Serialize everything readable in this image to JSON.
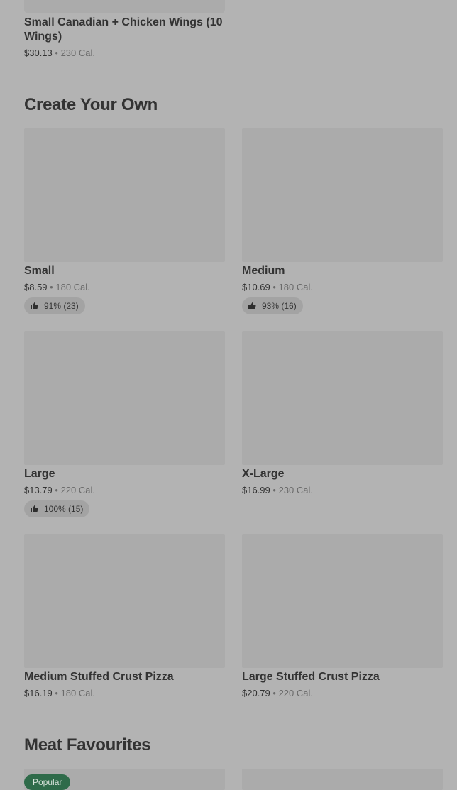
{
  "top_item": {
    "name": "Small Canadian + Chicken Wings (10 Wings)",
    "price": "$30.13",
    "separator": "•",
    "calories": "230 Cal."
  },
  "sections": {
    "create_your_own": {
      "title": "Create Your Own"
    },
    "meat_favourites": {
      "title": "Meat Favourites",
      "badge": "Popular"
    }
  },
  "items": {
    "small": {
      "name": "Small",
      "price": "$8.59",
      "calories": "180 Cal.",
      "rating": "91% (23)"
    },
    "medium": {
      "name": "Medium",
      "price": "$10.69",
      "calories": "180 Cal.",
      "rating": "93% (16)"
    },
    "large": {
      "name": "Large",
      "price": "$13.79",
      "calories": "220 Cal.",
      "rating": "100% (15)"
    },
    "xlarge": {
      "name": "X-Large",
      "price": "$16.99",
      "calories": "230 Cal."
    },
    "med_stuffed": {
      "name": "Medium Stuffed Crust Pizza",
      "price": "$16.19",
      "calories": "180 Cal."
    },
    "large_stuffed": {
      "name": "Large Stuffed Crust Pizza",
      "price": "$20.79",
      "calories": "220 Cal."
    }
  },
  "separator": "•",
  "icons": {
    "rating": "thumbs-up-icon"
  }
}
